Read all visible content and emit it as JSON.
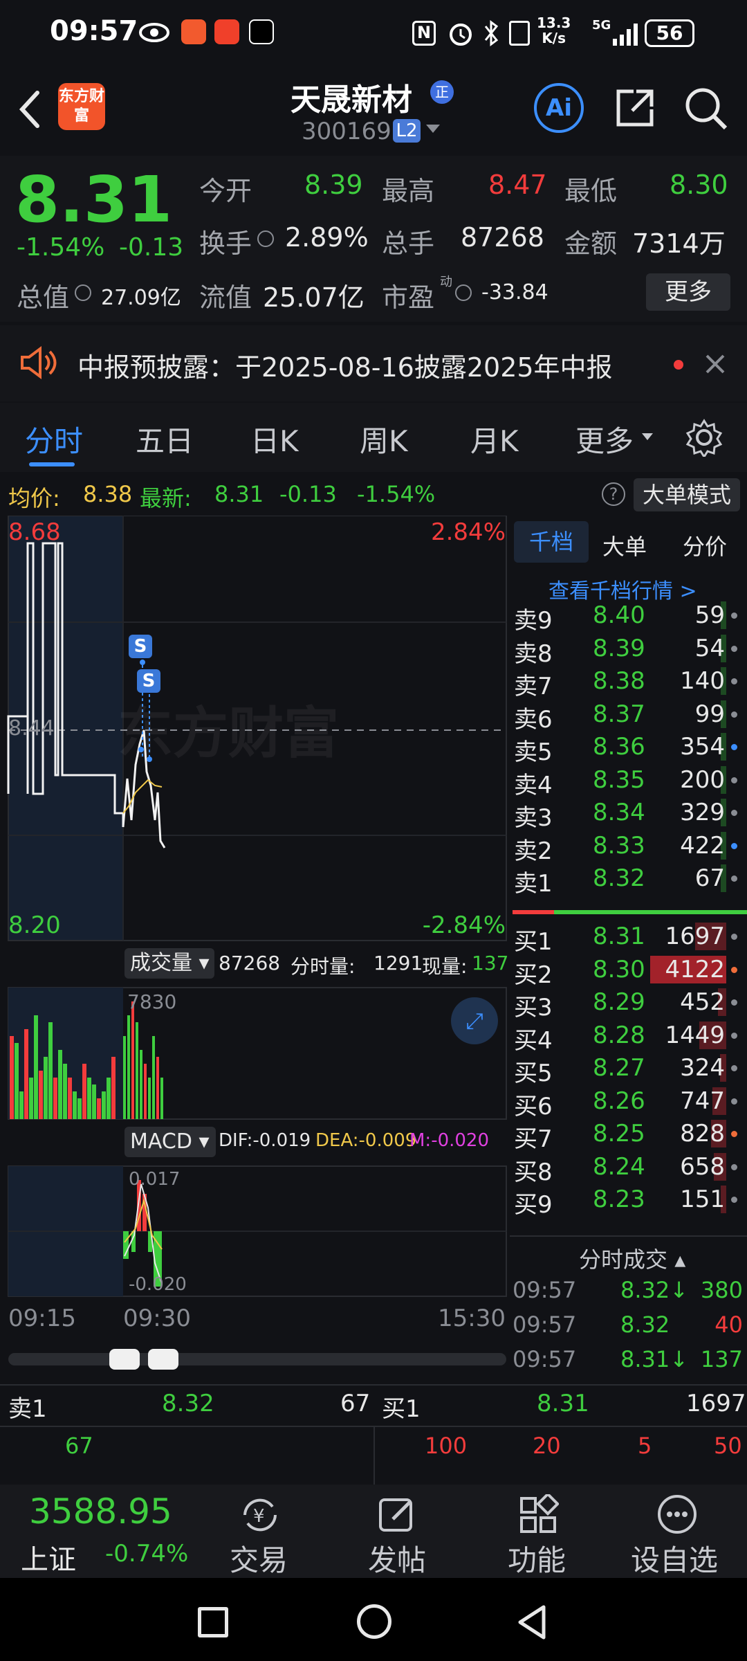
{
  "status": {
    "time": "09:57",
    "net_speed": "13.3",
    "net_unit": "K/s",
    "signal": "5G",
    "battery": "56"
  },
  "header": {
    "brand": "东方财富",
    "stock_name": "天晟新材",
    "badge": "正",
    "code": "300169",
    "level": "L2",
    "ai_label": "Ai"
  },
  "quote": {
    "price": "8.31",
    "change_pct": "-1.54%",
    "change": "-0.13",
    "fields": [
      {
        "label": "今开",
        "value": "8.39",
        "color": "g"
      },
      {
        "label": "最高",
        "value": "8.47",
        "color": "r"
      },
      {
        "label": "最低",
        "value": "8.30",
        "color": "g"
      },
      {
        "label": "换手",
        "value": "2.89%",
        "color": "w"
      },
      {
        "label": "总手",
        "value": "87268",
        "color": "w"
      },
      {
        "label": "金额",
        "value": "7314万",
        "color": "w"
      },
      {
        "label": "总值",
        "value": "27.09亿",
        "color": "w"
      },
      {
        "label": "流值",
        "value": "25.07亿",
        "color": "w"
      },
      {
        "label": "市盈",
        "value": "-33.84",
        "color": "w"
      }
    ],
    "pe_sup": "动",
    "more": "更多"
  },
  "notice": {
    "text": "中报预披露：于2025-08-16披露2025年中报"
  },
  "tabs": {
    "items": [
      "分时",
      "五日",
      "日K",
      "周K",
      "月K",
      "更多"
    ],
    "active": 0
  },
  "avgline": {
    "avg_label": "均价:",
    "avg": "8.38",
    "latest_label": "最新:",
    "latest": "8.31",
    "chg": "-0.13",
    "pct": "-1.54%",
    "mode": "大单模式"
  },
  "chart": {
    "y_high": "8.68",
    "y_mid": "8.44",
    "y_low": "8.20",
    "pct_high": "2.84%",
    "pct_low": "-2.84%",
    "watermark": "东方财富",
    "signal": "S",
    "volume": {
      "label": "成交量",
      "total": "87268",
      "tick_label": "分时量:",
      "tick": "1291",
      "now_label": "现量:",
      "now": "137",
      "max": "7830"
    },
    "macd": {
      "label": "MACD",
      "dif": "DIF:-0.019",
      "dea": "DEA:-0.009",
      "m": "M:-0.020",
      "top": "0.017",
      "bottom": "-0.020"
    },
    "times": [
      "09:15",
      "09:30",
      "15:30"
    ]
  },
  "book": {
    "tabs": [
      "千档",
      "大单",
      "分价"
    ],
    "link": "查看千档行情 >",
    "sells": [
      {
        "label": "卖9",
        "price": "8.40",
        "vol": "59"
      },
      {
        "label": "卖8",
        "price": "8.39",
        "vol": "54"
      },
      {
        "label": "卖7",
        "price": "8.38",
        "vol": "140"
      },
      {
        "label": "卖6",
        "price": "8.37",
        "vol": "99"
      },
      {
        "label": "卖5",
        "price": "8.36",
        "vol": "354"
      },
      {
        "label": "卖4",
        "price": "8.35",
        "vol": "200"
      },
      {
        "label": "卖3",
        "price": "8.34",
        "vol": "329"
      },
      {
        "label": "卖2",
        "price": "8.33",
        "vol": "422"
      },
      {
        "label": "卖1",
        "price": "8.32",
        "vol": "67"
      }
    ],
    "buys": [
      {
        "label": "买1",
        "price": "8.31",
        "vol": "1697"
      },
      {
        "label": "买2",
        "price": "8.30",
        "vol": "4122"
      },
      {
        "label": "买3",
        "price": "8.29",
        "vol": "452"
      },
      {
        "label": "买4",
        "price": "8.28",
        "vol": "1449"
      },
      {
        "label": "买5",
        "price": "8.27",
        "vol": "324"
      },
      {
        "label": "买6",
        "price": "8.26",
        "vol": "747"
      },
      {
        "label": "买7",
        "price": "8.25",
        "vol": "828"
      },
      {
        "label": "买8",
        "price": "8.24",
        "vol": "658"
      },
      {
        "label": "买9",
        "price": "8.23",
        "vol": "151"
      }
    ],
    "ticks_title": "分时成交",
    "ticks": [
      {
        "time": "09:57",
        "price": "8.32↓",
        "vol": "380",
        "pc": "g",
        "vc": "g"
      },
      {
        "time": "09:57",
        "price": "8.32",
        "vol": "40",
        "pc": "g",
        "vc": "r"
      },
      {
        "time": "09:57",
        "price": "8.31↓",
        "vol": "137",
        "pc": "g",
        "vc": "g"
      }
    ]
  },
  "bottom": {
    "sell_label": "卖1",
    "sell_price": "8.32",
    "sell_vol": "67",
    "buy_label": "买1",
    "buy_price": "8.31",
    "buy_vol": "1697",
    "sell_q": [
      "67"
    ],
    "buy_q": [
      "100",
      "20",
      "5",
      "50"
    ]
  },
  "nav": {
    "index_value": "3588.95",
    "index_name": "上证",
    "index_pct": "-0.74%",
    "items": [
      "交易",
      "发帖",
      "功能",
      "设自选"
    ]
  }
}
